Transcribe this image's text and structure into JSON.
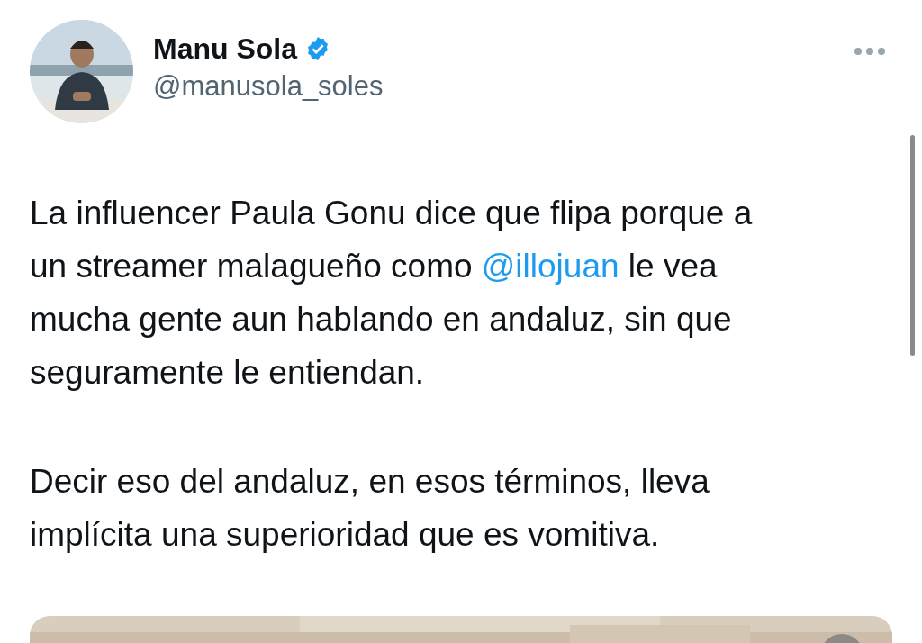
{
  "author": {
    "name": "Manu Sola",
    "verified": true,
    "handle": "@manusola_soles"
  },
  "body": {
    "paragraphs": [
      [
        [
          {
            "text": "La influencer Paula Gonu dice que flipa porque a"
          }
        ],
        [
          {
            "text": "un streamer malagueño como "
          },
          {
            "text": "@illojuan",
            "kind": "mention"
          },
          {
            "text": " le vea"
          }
        ],
        [
          {
            "text": "mucha gente aun hablando en andaluz, sin que"
          }
        ],
        [
          {
            "text": "seguramente le entiendan."
          }
        ]
      ],
      [
        [
          {
            "text": "Decir eso del andaluz, en esos términos, lleva"
          }
        ],
        [
          {
            "text": "implícita una superioridad que es vomitiva."
          }
        ]
      ]
    ]
  }
}
